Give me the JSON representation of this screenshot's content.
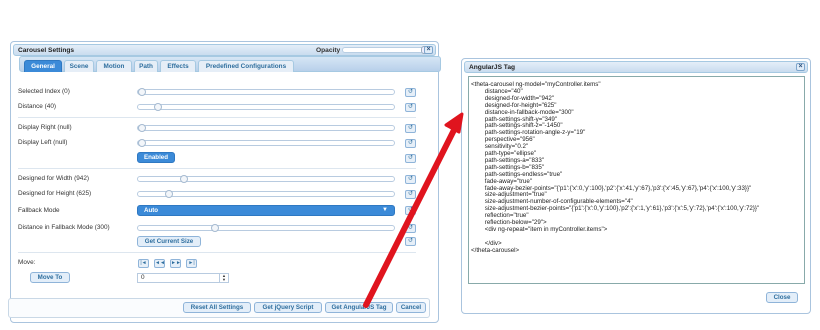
{
  "carousel_settings": {
    "title": "Carousel Settings",
    "opacity_label": "Opacity",
    "close_label": "×",
    "tabs": [
      "General",
      "Scene",
      "Motion",
      "Path",
      "Effects",
      "Predefined Configurations"
    ],
    "active_tab": "General",
    "rows": {
      "selected_index": {
        "label": "Selected Index (0)",
        "fraction": 0.0
      },
      "distance": {
        "label": "Distance (40)",
        "fraction": 0.08
      },
      "display_right": {
        "label": "Display Right (null)",
        "fraction": 0.0
      },
      "display_left": {
        "label": "Display Left (null)",
        "fraction": 0.0
      },
      "enabled_label": "Enabled",
      "designed_width": {
        "label": "Designed for Width (942)",
        "fraction": 0.18
      },
      "designed_height": {
        "label": "Designed for Height (625)",
        "fraction": 0.12
      },
      "fallback_mode": {
        "label": "Fallback Mode",
        "value": "Auto"
      },
      "distance_fallback": {
        "label": "Distance in Fallback Mode (300)",
        "fraction": 0.3
      },
      "get_current_size": "Get Current Size",
      "move": {
        "label": "Move:",
        "nav": [
          "|◄",
          "◄◄",
          "►►",
          "►|"
        ]
      },
      "move_to": {
        "label": "Move To",
        "value": "0"
      }
    },
    "reset_glyph": "↺",
    "footer_buttons": [
      "Reset All Settings",
      "Get jQuery Script",
      "Get AngularJS Tag",
      "Cancel"
    ]
  },
  "angular_tag": {
    "title": "AngularJS Tag",
    "close_label": "×",
    "close_button": "Close",
    "code_lines": [
      "<theta-carousel ng-model=\"myController.items\"",
      "        distance=\"40\"",
      "        designed-for-width=\"942\"",
      "        designed-for-height=\"625\"",
      "        distance-in-fallback-mode=\"300\"",
      "        path-settings-shift-y=\"349\"",
      "        path-settings-shift-z=\"-1450\"",
      "        path-settings-rotation-angle-z-y=\"19\"",
      "        perspective=\"956\"",
      "        sensitivity=\"0.2\"",
      "        path-type=\"ellipse\"",
      "        path-settings-a=\"833\"",
      "        path-settings-b=\"835\"",
      "        path-settings-endless=\"true\"",
      "        fade-away=\"true\"",
      "        fade-away-bezier-points=\"{'p1':{'x':0,'y':100},'p2':{'x':41,'y':67},'p3':{'x':45,'y':67},'p4':{'x':100,'y':33}}\"",
      "        size-adjustment=\"true\"",
      "        size-adjustment-number-of-configurable-elements=\"4\"",
      "        size-adjustment-bezier-points=\"{'p1':{'x':0,'y':100},'p2':{'x':1,'y':61},'p3':{'x':5,'y':72},'p4':{'x':100,'y':72}}\"",
      "        reflection=\"true\"",
      "        reflection-below=\"29\">",
      "        <div ng-repeat=\"item in myController.items\">",
      "",
      "        </div>",
      "</theta-carousel>"
    ]
  },
  "colors": {
    "accent": "#3b8ad8",
    "arrow": "#e0141e"
  }
}
